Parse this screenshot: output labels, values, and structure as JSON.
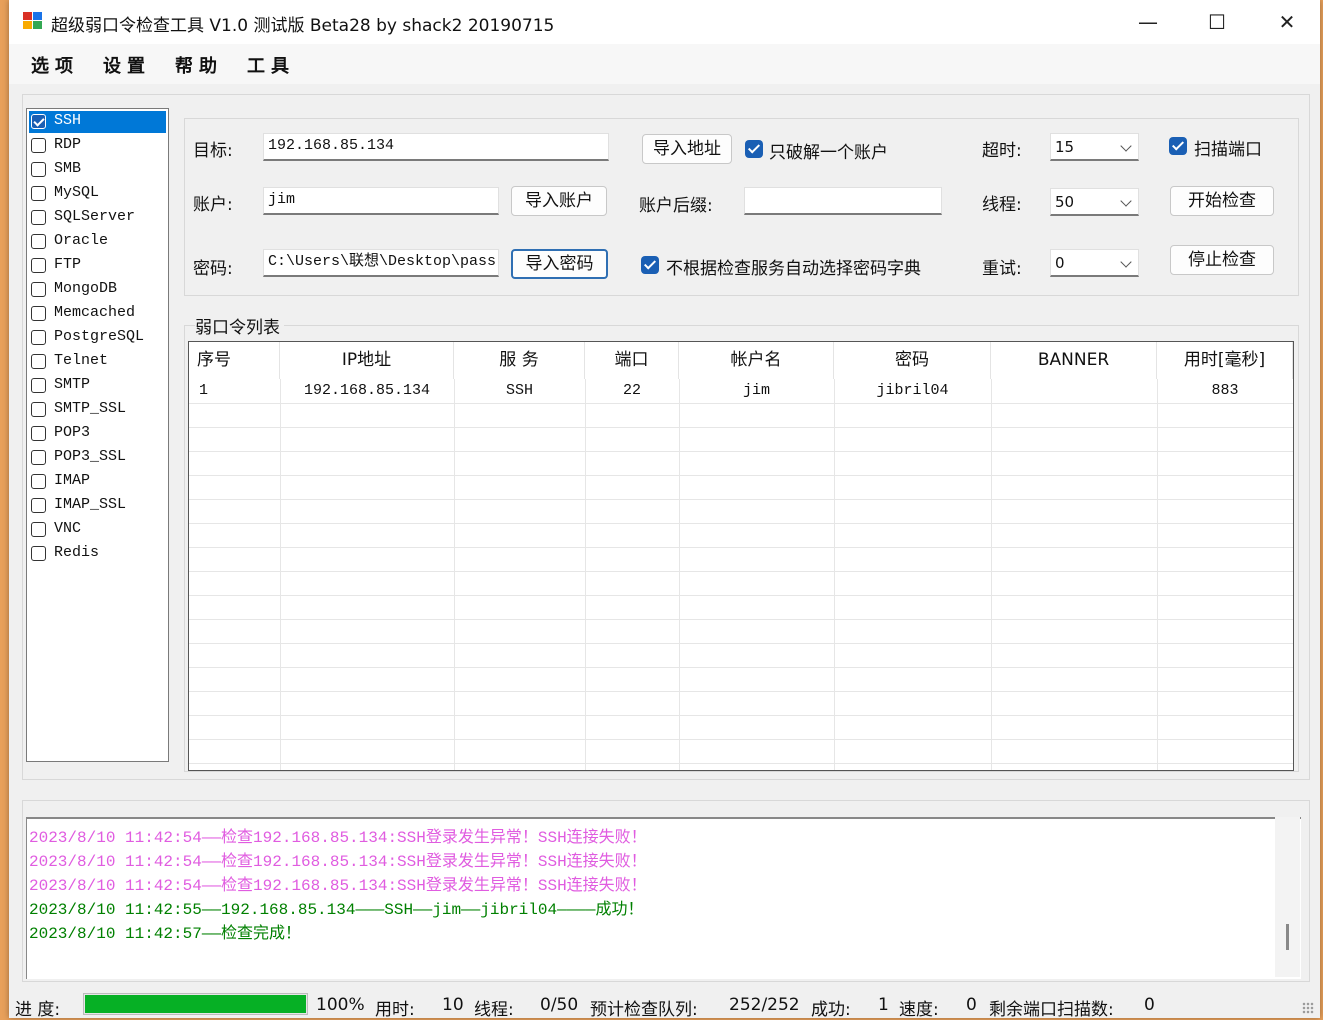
{
  "window": {
    "title": "超级弱口令检查工具 V1.0 测试版 Beta28 by shack2 20190715",
    "minimize": "—",
    "maximize": "☐",
    "close": "✕"
  },
  "menu": [
    "选项",
    "设置",
    "帮助",
    "工具"
  ],
  "services": [
    {
      "label": "SSH",
      "checked": true
    },
    {
      "label": "RDP",
      "checked": false
    },
    {
      "label": "SMB",
      "checked": false
    },
    {
      "label": "MySQL",
      "checked": false
    },
    {
      "label": "SQLServer",
      "checked": false
    },
    {
      "label": "Oracle",
      "checked": false
    },
    {
      "label": "FTP",
      "checked": false
    },
    {
      "label": "MongoDB",
      "checked": false
    },
    {
      "label": "Memcached",
      "checked": false
    },
    {
      "label": "PostgreSQL",
      "checked": false
    },
    {
      "label": "Telnet",
      "checked": false
    },
    {
      "label": "SMTP",
      "checked": false
    },
    {
      "label": "SMTP_SSL",
      "checked": false
    },
    {
      "label": "POP3",
      "checked": false
    },
    {
      "label": "POP3_SSL",
      "checked": false
    },
    {
      "label": "IMAP",
      "checked": false
    },
    {
      "label": "IMAP_SSL",
      "checked": false
    },
    {
      "label": "VNC",
      "checked": false
    },
    {
      "label": "Redis",
      "checked": false
    }
  ],
  "form": {
    "target_label": "目标:",
    "target_value": "192.168.85.134",
    "import_address": "导入地址",
    "only_one_account": "只破解一个账户",
    "account_label": "账户:",
    "account_value": "jim",
    "import_account": "导入账户",
    "suffix_label": "账户后缀:",
    "suffix_value": "",
    "password_label": "密码:",
    "password_value": "C:\\Users\\联想\\Desktop\\pass",
    "import_password": "导入密码",
    "no_auto_dict": "不根据检查服务自动选择密码字典",
    "timeout_label": "超时:",
    "timeout_value": "15",
    "threads_label": "线程:",
    "threads_value": "50",
    "retry_label": "重试:",
    "retry_value": "0",
    "scan_port": "扫描端口",
    "start_check": "开始检查",
    "stop_check": "停止检查"
  },
  "results": {
    "title": "弱口令列表",
    "columns": [
      "序号",
      "IP地址",
      "服 务",
      "端口",
      "帐户名",
      "密码",
      "BANNER",
      "用时[毫秒]"
    ],
    "rows": [
      [
        "1",
        "192.168.85.134",
        "SSH",
        "22",
        "jim",
        "jibril04",
        "",
        "883"
      ]
    ]
  },
  "log": [
    {
      "text": "2023/8/10 11:42:54——检查192.168.85.134:SSH登录发生异常！SSH连接失败！",
      "color": "#e05ce0"
    },
    {
      "text": "2023/8/10 11:42:54——检查192.168.85.134:SSH登录发生异常！SSH连接失败！",
      "color": "#e05ce0"
    },
    {
      "text": "2023/8/10 11:42:54——检查192.168.85.134:SSH登录发生异常！SSH连接失败！",
      "color": "#e05ce0"
    },
    {
      "text": "2023/8/10 11:42:55——192.168.85.134———SSH——jim——jibril04————成功！",
      "color": "#008000"
    },
    {
      "text": "2023/8/10 11:42:57——检查完成！",
      "color": "#008000"
    }
  ],
  "status": {
    "progress_label": "进 度:",
    "progress_percent": 100,
    "progress_text": "100%",
    "time_label": "用时:",
    "time_value": "10",
    "threads_label": "线程:",
    "threads_value": "0/50",
    "queue_label": "预计检查队列:",
    "queue_value": "252/252",
    "success_label": "成功:",
    "success_value": "1",
    "speed_label": "速度:",
    "speed_value": "0",
    "remaining_label": "剩余端口扫描数:",
    "remaining_value": "0"
  },
  "colors": {
    "accent": "#1a5fb4",
    "progress": "#06b025",
    "log_error": "#e05ce0",
    "log_success": "#008000"
  }
}
